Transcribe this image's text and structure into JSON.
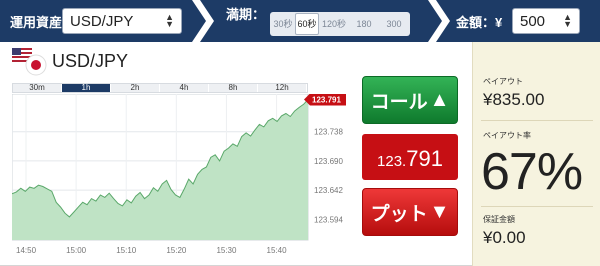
{
  "topbar": {
    "asset_label": "運用資産",
    "asset_value": "USD/JPY",
    "expiry_label": "満期：",
    "expiry_options": [
      "30秒",
      "60秒",
      "120秒",
      "180",
      "300"
    ],
    "expiry_selected": "60秒",
    "amount_label": "金額：¥",
    "amount_value": "500"
  },
  "chart_panel": {
    "asset_title": "USD/JPY",
    "timeframes": [
      "30m",
      "1h",
      "2h",
      "4h",
      "8h",
      "12h"
    ],
    "timeframe_selected": "1h"
  },
  "chart_data": {
    "type": "area",
    "current_price_label": "123.791",
    "y_ticks": [
      "123.738",
      "123.690",
      "123.642",
      "123.594"
    ],
    "x_ticks": [
      "14:50",
      "15:00",
      "15:10",
      "15:20",
      "15:30",
      "15:40"
    ],
    "ylim": [
      123.56,
      123.8
    ],
    "series": [
      {
        "values": [
          123.636,
          123.639,
          123.645,
          123.64,
          123.647,
          123.645,
          123.65,
          123.648,
          123.644,
          123.64,
          123.622,
          123.614,
          123.604,
          123.598,
          123.606,
          123.614,
          123.622,
          123.618,
          123.628,
          123.624,
          123.634,
          123.63,
          123.637,
          123.628,
          123.62,
          123.616,
          123.626,
          123.621,
          123.632,
          123.638,
          123.628,
          123.634,
          123.646,
          123.64,
          123.652,
          123.658,
          123.643,
          123.634,
          123.63,
          123.644,
          123.66,
          123.652,
          123.668,
          123.676,
          123.68,
          123.696,
          123.7,
          123.69,
          123.706,
          123.711,
          123.718,
          123.714,
          123.73,
          123.736,
          123.731,
          123.741,
          123.75,
          123.746,
          123.756,
          123.76,
          123.755,
          123.764,
          123.768,
          123.763,
          123.772,
          123.778,
          123.783,
          123.791
        ]
      }
    ],
    "fill_color": "#bfe3c5",
    "line_color": "#5aa86a"
  },
  "trade": {
    "call_label": "コール",
    "price_prefix": "123.",
    "price_suffix": "791",
    "put_label": "プット"
  },
  "payout_panel": {
    "payout_label": "ペイアウト",
    "payout_value": "¥835.00",
    "rate_label": "ペイアウト率",
    "rate_value": "67%",
    "guarantee_label": "保証金額",
    "guarantee_value": "¥0.00"
  }
}
